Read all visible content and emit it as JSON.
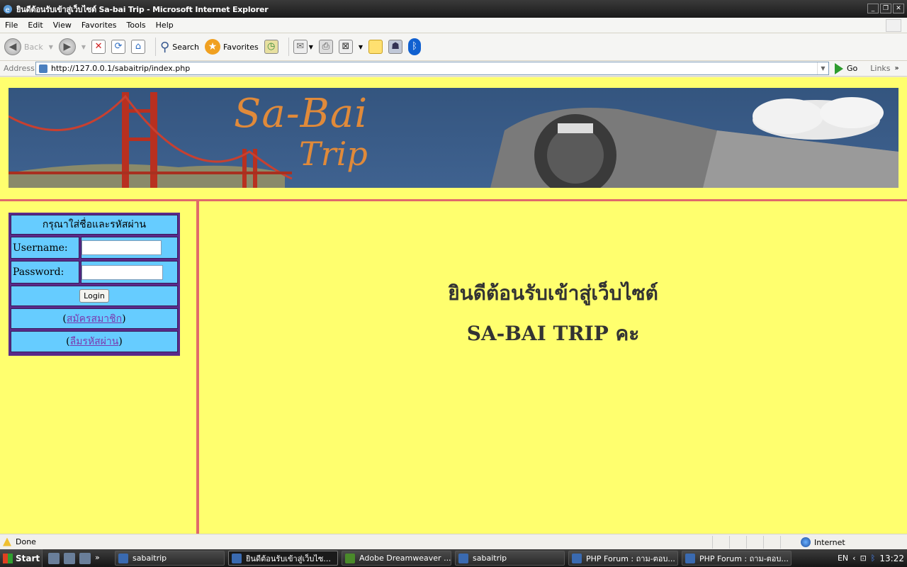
{
  "window": {
    "title": "ยินดีต้อนรับเข้าสู่เว็บไซต์ Sa-bai Trip - Microsoft Internet Explorer"
  },
  "menu": [
    "File",
    "Edit",
    "View",
    "Favorites",
    "Tools",
    "Help"
  ],
  "toolbar": {
    "back": "Back",
    "search": "Search",
    "favorites": "Favorites"
  },
  "address": {
    "label": "Address",
    "url": "http://127.0.0.1/sabaitrip/index.php",
    "go": "Go",
    "links": "Links"
  },
  "banner": {
    "logo_line1": "Sa-Bai",
    "logo_line2": "Trip"
  },
  "login": {
    "heading": "กรุณาใส่ชื่อและรหัสผ่าน",
    "username_label": "Username:",
    "password_label": "Password:",
    "login_button": "Login",
    "register_link": "สมัครสมาชิก",
    "forgot_link": "ลืมรหัสผ่าน"
  },
  "main": {
    "welcome_line1": "ยินดีต้อนรับเข้าสู่เว็บไซต์",
    "welcome_line2": "SA-BAI TRIP คะ"
  },
  "status": {
    "text": "Done",
    "zone": "Internet"
  },
  "taskbar": {
    "start": "Start",
    "tasks": [
      "sabaitrip",
      "ยินดีต้อนรับเข้าสู่เว็บไซ...",
      "Adobe Dreamweaver ...",
      "sabaitrip",
      "PHP Forum : ถาม-ตอบ...",
      "PHP Forum : ถาม-ตอบ..."
    ],
    "lang": "EN",
    "clock": "13:22"
  }
}
